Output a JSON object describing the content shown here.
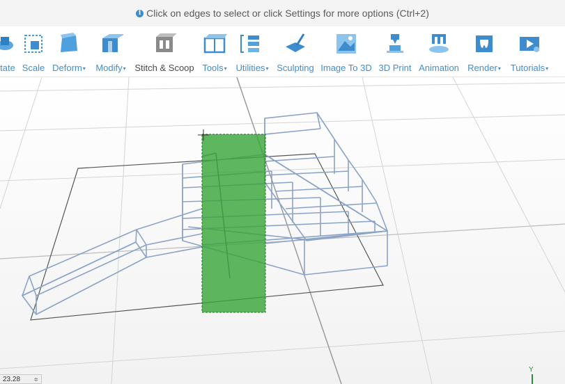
{
  "hint": {
    "icon": "info-icon",
    "text": "Click on edges to select or click Settings for more options (Ctrl+2)"
  },
  "toolbar": {
    "items": [
      {
        "label": "tate",
        "icon": "rotate-icon",
        "dropdown": false
      },
      {
        "label": "Scale",
        "icon": "scale-icon",
        "dropdown": false
      },
      {
        "label": "Deform",
        "icon": "deform-icon",
        "dropdown": true
      },
      {
        "label": "Modify",
        "icon": "modify-icon",
        "dropdown": true
      },
      {
        "label": "Stitch & Scoop",
        "icon": "stitch-scoop-icon",
        "dropdown": false
      },
      {
        "label": "Tools",
        "icon": "tools-icon",
        "dropdown": true
      },
      {
        "label": "Utilities",
        "icon": "utilities-icon",
        "dropdown": true
      },
      {
        "label": "Sculpting",
        "icon": "sculpting-icon",
        "dropdown": false
      },
      {
        "label": "Image To 3D",
        "icon": "image-to-3d-icon",
        "dropdown": false
      },
      {
        "label": "3D Print",
        "icon": "3d-print-icon",
        "dropdown": false
      },
      {
        "label": "Animation",
        "icon": "animation-icon",
        "dropdown": false
      },
      {
        "label": "Render",
        "icon": "render-icon",
        "dropdown": true
      },
      {
        "label": "Tutorials",
        "icon": "tutorials-icon",
        "dropdown": true
      }
    ],
    "caret": "▾"
  },
  "viewport": {
    "zoom_value": "23.28",
    "axis_label": "Y",
    "selection_color": "#3aa63a",
    "wire_color": "#8aa3c8"
  }
}
